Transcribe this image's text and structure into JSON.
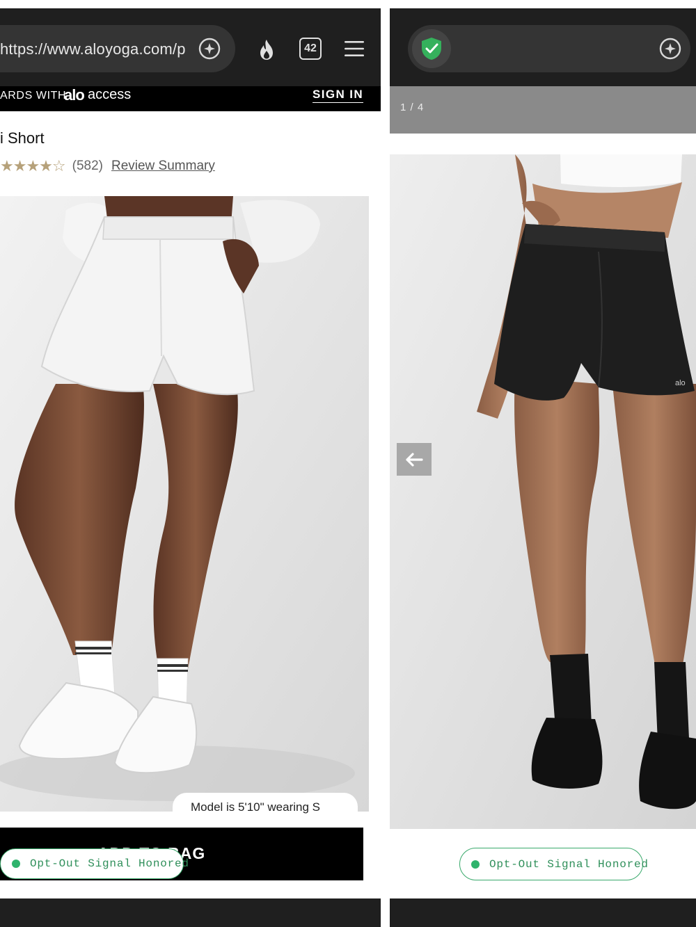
{
  "left": {
    "browser": {
      "url": "https://www.aloyoga.com/p",
      "tab_count": "42"
    },
    "promo": {
      "text": "ARDS WITH",
      "logo": "alo",
      "logo_suffix": "access",
      "sign_in": "SIGN IN"
    },
    "product": {
      "title": "i Short",
      "rating_stars": 4.5,
      "review_count": "(582)",
      "review_link": "Review Summary"
    },
    "model_note": "Model is 5'10\" wearing S",
    "add_to_bag": "ADD TO BAG",
    "optout": "Opt-Out Signal Honored"
  },
  "right": {
    "gallery_counter": "1 / 4",
    "optout": "Opt-Out Signal Honored"
  },
  "icons": {
    "ai_assistant": "sparkle-icon",
    "hot": "flame-icon",
    "tabs": "tab-count-icon",
    "menu": "hamburger-menu-icon",
    "security": "shield-check-icon",
    "prev": "arrow-left-icon"
  },
  "colors": {
    "chrome": "#1f1f1f",
    "urlbar": "#343434",
    "accent_green": "#2fb36c",
    "star": "#b6a17a"
  }
}
